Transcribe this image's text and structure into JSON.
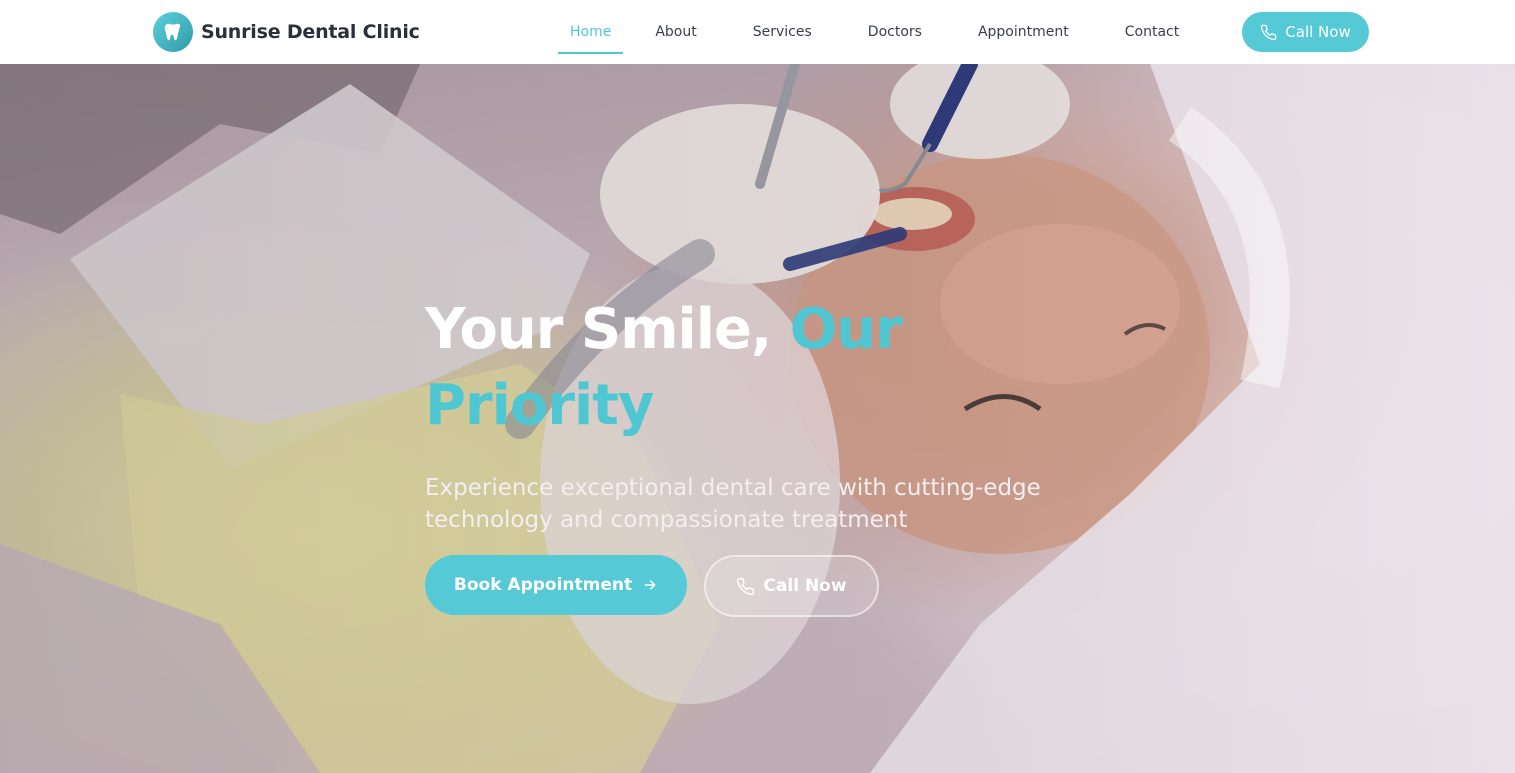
{
  "brand": {
    "name": "Sunrise Dental Clinic",
    "logo_icon": "tooth-icon"
  },
  "nav": {
    "items": [
      {
        "label": "Home",
        "active": true
      },
      {
        "label": "About",
        "active": false
      },
      {
        "label": "Services",
        "active": false
      },
      {
        "label": "Doctors",
        "active": false
      },
      {
        "label": "Appointment",
        "active": false
      },
      {
        "label": "Contact",
        "active": false
      }
    ],
    "call_button": {
      "label": "Call Now",
      "icon": "phone-icon"
    }
  },
  "hero": {
    "title_main": "Your Smile,",
    "title_accent_1": "Our",
    "title_accent_2": "Priority",
    "subtitle": "Experience exceptional dental care with cutting-edge technology and compassionate treatment",
    "primary_button": {
      "label": "Book Appointment",
      "icon": "arrow-right-icon"
    },
    "secondary_button": {
      "label": "Call Now",
      "icon": "phone-icon"
    },
    "background_image": "dentist-treating-patient-photo"
  },
  "colors": {
    "accent": "#55c9d6",
    "text_dark": "#2b2f38",
    "nav_text": "#3a3f4a",
    "white": "#ffffff"
  }
}
